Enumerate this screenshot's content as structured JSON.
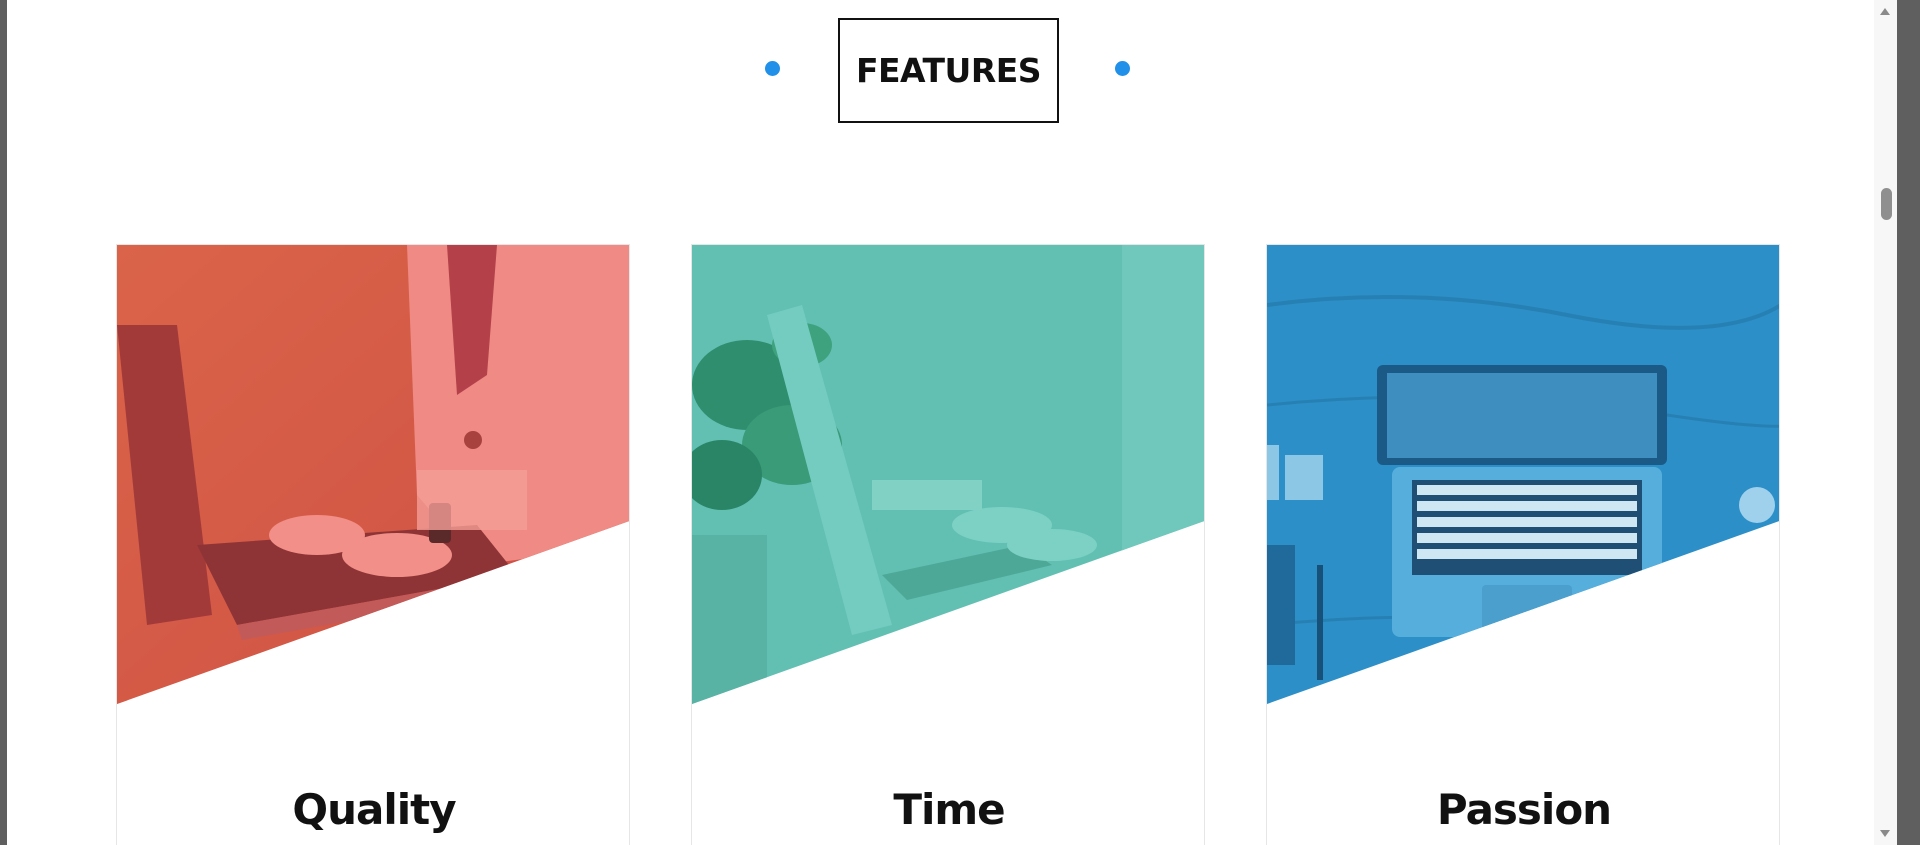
{
  "section": {
    "title": "FEATURES",
    "accent_color": "#2190e8"
  },
  "cards": [
    {
      "title": "Quality",
      "image_icon": "laptop-typing-photo",
      "overlay_color": "#e8574c"
    },
    {
      "title": "Time",
      "image_icon": "plant-laptop-photo",
      "overlay_color": "#5bbfb1"
    },
    {
      "title": "Passion",
      "image_icon": "desk-laptop-photo",
      "overlay_color": "#2d8fc7"
    }
  ]
}
